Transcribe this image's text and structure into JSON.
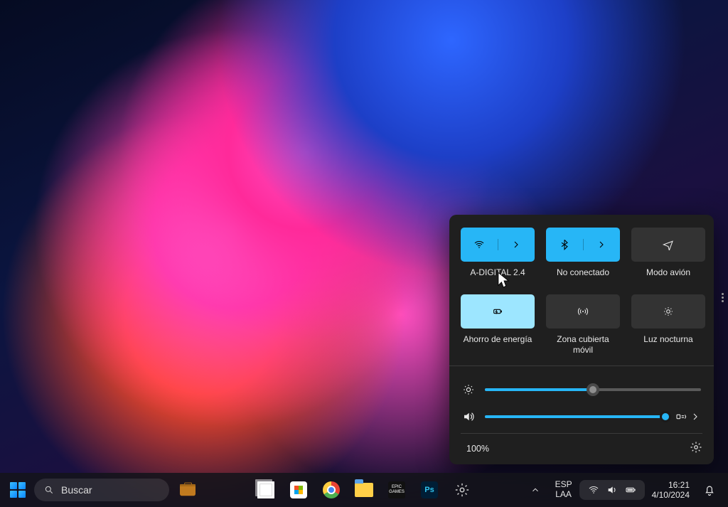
{
  "taskbar": {
    "search_label": "Buscar",
    "epic_text": "EPIC GAMES",
    "ps_text": "Ps",
    "lang_top": "ESP",
    "lang_bottom": "LAA",
    "time": "16:21",
    "date": "4/10/2024"
  },
  "flyout": {
    "tiles": [
      {
        "label": "A-DIGITAL 2.4"
      },
      {
        "label": "No conectado"
      },
      {
        "label": "Modo avión"
      },
      {
        "label": "Ahorro de energía"
      },
      {
        "label": "Zona cubierta móvil"
      },
      {
        "label": "Luz nocturna"
      }
    ],
    "brightness_percent": 50,
    "volume_percent": 100,
    "battery_text": "100%"
  }
}
